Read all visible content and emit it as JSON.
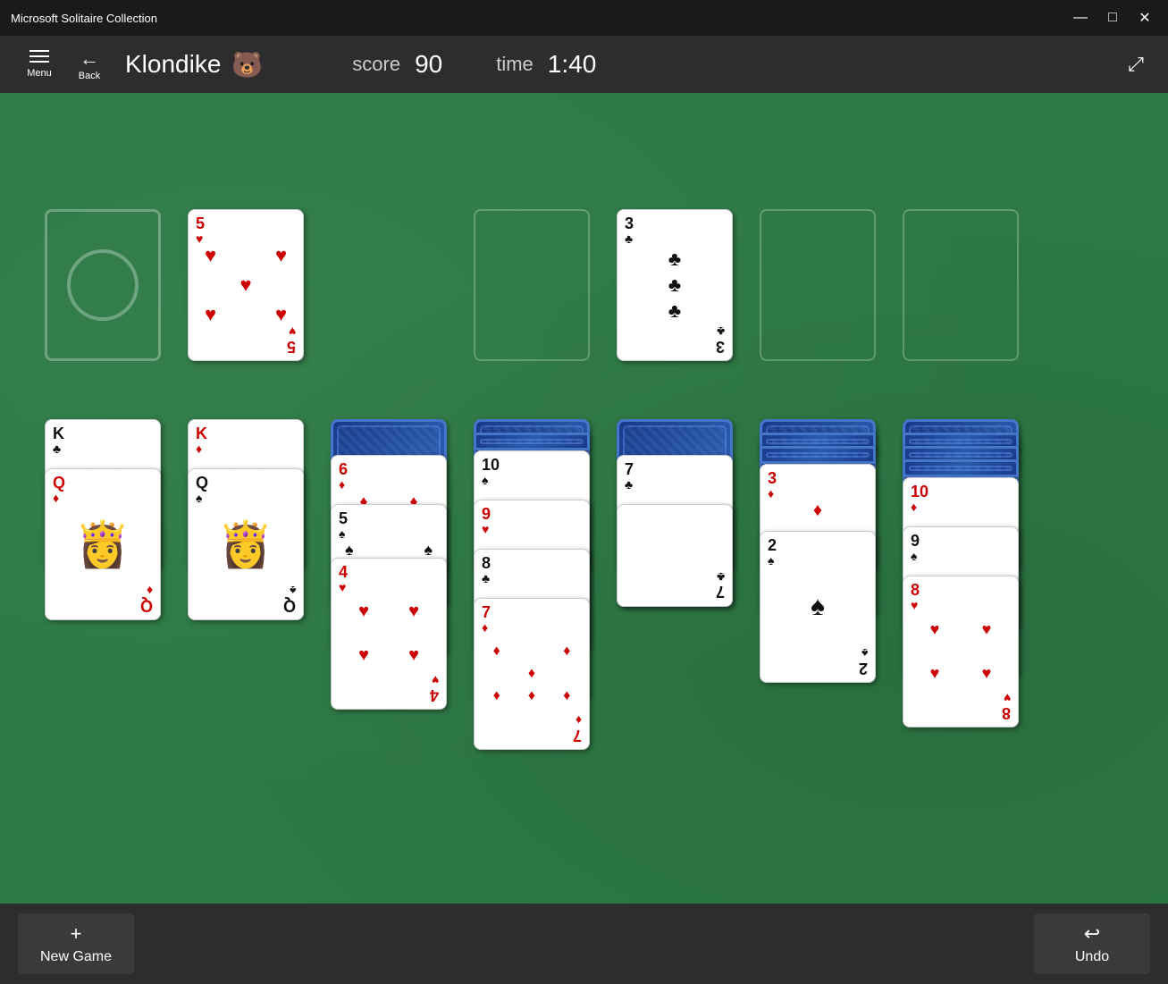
{
  "titleBar": {
    "title": "Microsoft Solitaire Collection",
    "minBtn": "—",
    "maxBtn": "□",
    "closeBtn": "✕"
  },
  "nav": {
    "menuLabel": "Menu",
    "backLabel": "Back",
    "gameTitle": "Klondike",
    "scoreLabel": "score",
    "scoreValue": "90",
    "timeLabel": "time",
    "timeValue": "1:40"
  },
  "bottomBar": {
    "newGameLabel": "New Game",
    "newGameIcon": "+",
    "undoLabel": "Undo",
    "undoIcon": "↩"
  },
  "game": {
    "stockEmpty": true
  }
}
